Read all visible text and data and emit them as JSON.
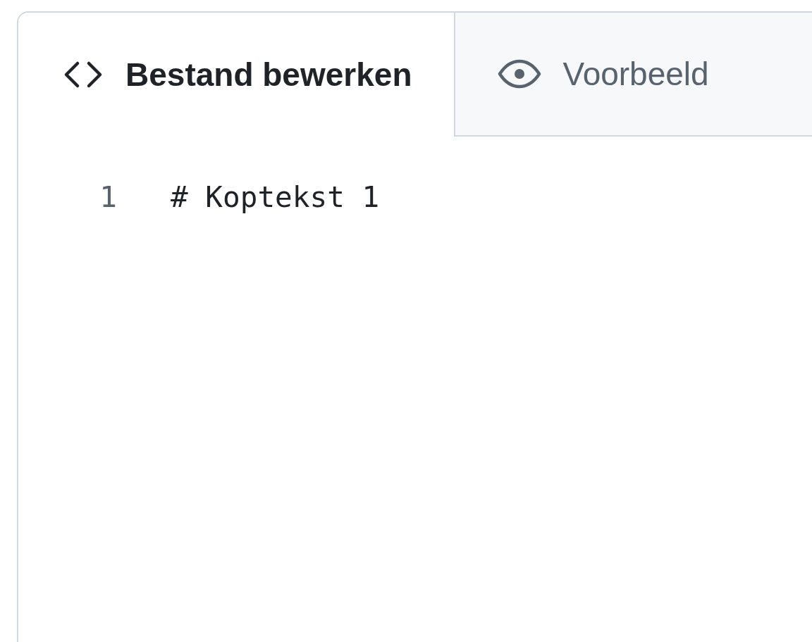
{
  "tabs": [
    {
      "label": "Bestand bewerken",
      "selected": true
    },
    {
      "label": "Voorbeeld",
      "selected": false
    }
  ],
  "editor": {
    "lines": [
      {
        "number": "1",
        "text": "# Koptekst 1"
      }
    ]
  }
}
